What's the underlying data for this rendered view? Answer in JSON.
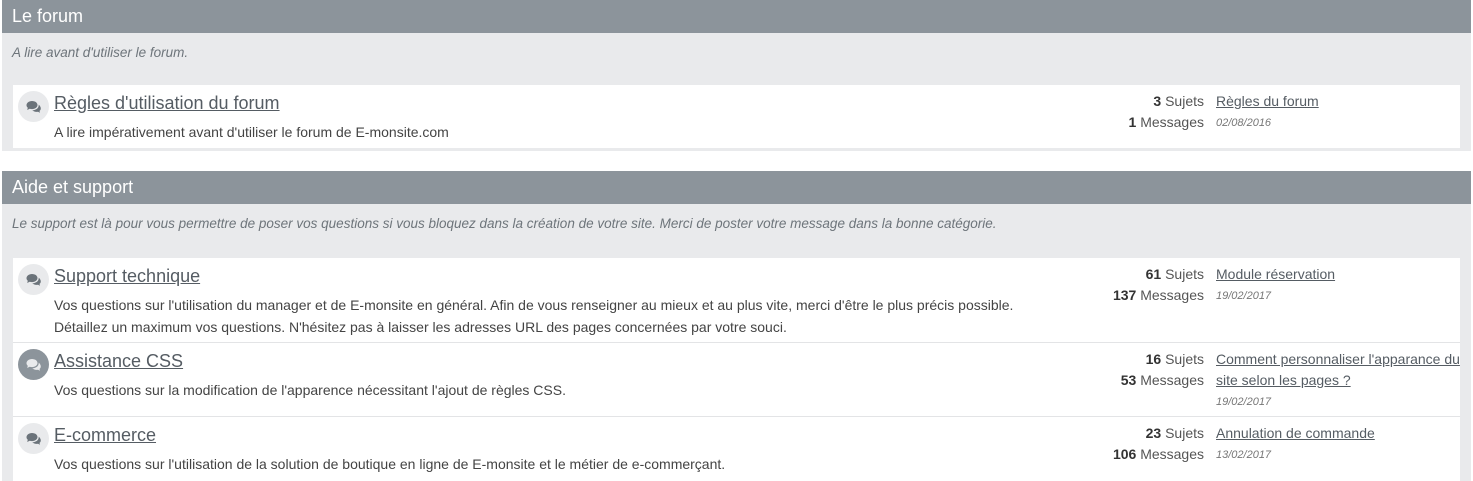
{
  "sections": [
    {
      "title": "Le forum",
      "description": "A lire avant d'utiliser le forum.",
      "forums": [
        {
          "title": "Règles d'utilisation du forum",
          "description": "A lire impérativement avant d'utiliser le forum de E-monsite.com",
          "topics_count": "3",
          "topics_label": "Sujets",
          "messages_count": "1",
          "messages_label": "Messages",
          "last_post_title": "Règles du forum",
          "last_post_date": "02/08/2016"
        }
      ]
    },
    {
      "title": "Aide et support",
      "description": "Le support est là pour vous permettre de poser vos questions si vous bloquez dans la création de votre site. Merci de poster votre message dans la bonne catégorie.",
      "forums": [
        {
          "title": "Support technique",
          "description": "Vos questions sur l'utilisation du manager et de E-monsite en général. Afin de vous renseigner au mieux et au plus vite, merci d'être le plus précis possible. Détaillez un maximum vos questions. N'hésitez pas à laisser les adresses URL des pages concernées par votre souci.",
          "topics_count": "61",
          "topics_label": "Sujets",
          "messages_count": "137",
          "messages_label": "Messages",
          "last_post_title": "Module réservation",
          "last_post_date": "19/02/2017"
        },
        {
          "title": "Assistance CSS",
          "description": "Vos questions sur la modification de l'apparence nécessitant l'ajout de règles CSS.",
          "topics_count": "16",
          "topics_label": "Sujets",
          "messages_count": "53",
          "messages_label": "Messages",
          "last_post_title": "Comment personnaliser l'apparance du site selon les pages ?",
          "last_post_date": "19/02/2017"
        },
        {
          "title": "E-commerce",
          "description": "Vos questions sur l'utilisation de la solution de boutique en ligne de E-monsite et le métier de e-commerçant.",
          "topics_count": "23",
          "topics_label": "Sujets",
          "messages_count": "106",
          "messages_label": "Messages",
          "last_post_title": "Annulation de commande",
          "last_post_date": "13/02/2017"
        }
      ]
    }
  ],
  "icons": {
    "forum": "comments-icon",
    "forum_unread": "comments-icon"
  },
  "colors": {
    "header_bg": "#8c949b",
    "section_bg": "#e9eaec",
    "link": "#555c63"
  }
}
